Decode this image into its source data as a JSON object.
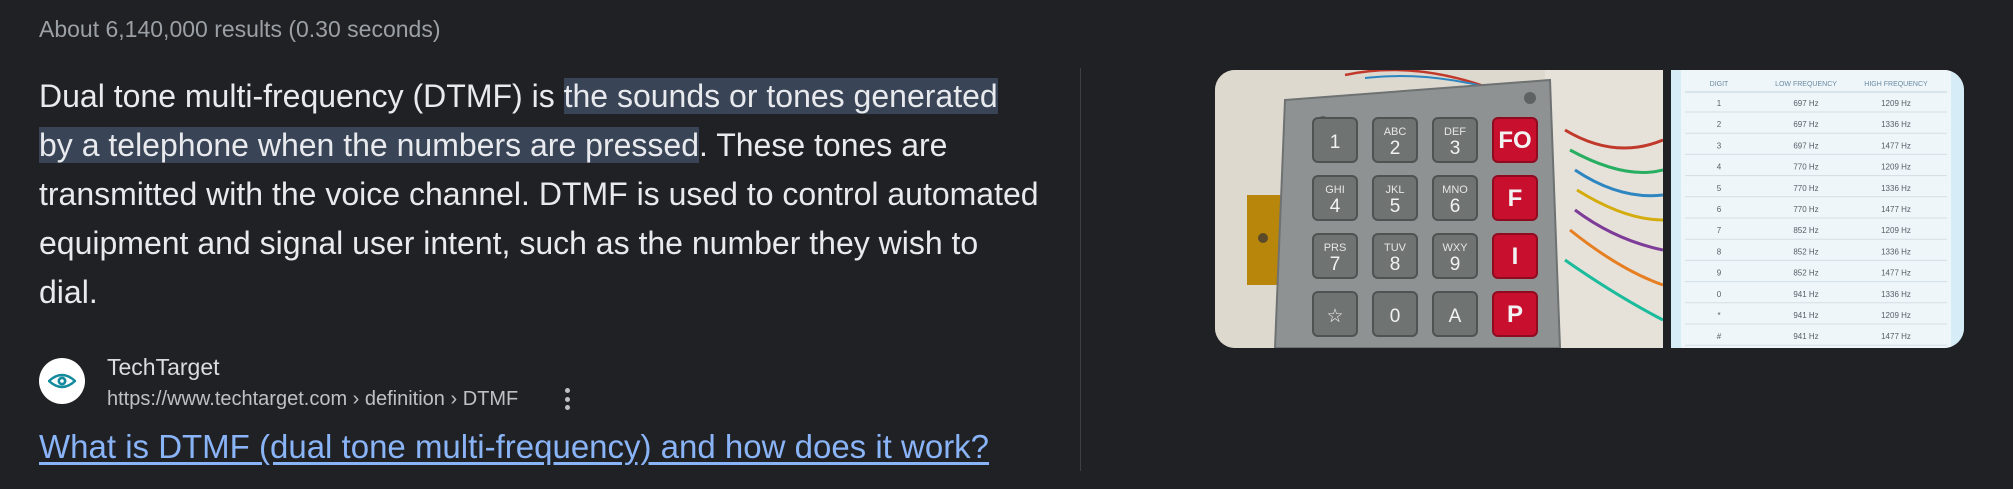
{
  "stats_text": "About 6,140,000 results (0.30 seconds)",
  "snippet": {
    "part1": "Dual tone multi-frequency (DTMF) is ",
    "highlight": "the sounds or tones generated by a telephone when the numbers are pressed",
    "part2": ". These tones are transmitted with the voice channel. DTMF is used to control automated equipment and signal user intent, such as the number they wish to dial."
  },
  "source": {
    "name": "TechTarget",
    "url": "https://www.techtarget.com › definition › DTMF",
    "favicon": "eye-icon"
  },
  "result_title": "What is DTMF (dual tone multi-frequency) and how does it work?",
  "colors": {
    "background": "#202124",
    "link": "#8ab4f8",
    "highlight": "#394457"
  },
  "keypad_keys": [
    {
      "main": "1",
      "letters": ""
    },
    {
      "main": "2",
      "letters": "ABC"
    },
    {
      "main": "3",
      "letters": "DEF"
    },
    {
      "main": "FO",
      "letters": "",
      "red": true
    },
    {
      "main": "4",
      "letters": "GHI"
    },
    {
      "main": "5",
      "letters": "JKL"
    },
    {
      "main": "6",
      "letters": "MNO"
    },
    {
      "main": "F",
      "letters": "",
      "red": true
    },
    {
      "main": "7",
      "letters": "PRS"
    },
    {
      "main": "8",
      "letters": "TUV"
    },
    {
      "main": "9",
      "letters": "WXY"
    },
    {
      "main": "I",
      "letters": "",
      "red": true
    },
    {
      "main": "☆",
      "letters": ""
    },
    {
      "main": "0",
      "letters": ""
    },
    {
      "main": "A",
      "letters": ""
    },
    {
      "main": "P",
      "letters": "",
      "red": true
    }
  ],
  "freq_table": {
    "headers": [
      "DIGIT",
      "LOW FREQUENCY",
      "HIGH FREQUENCY"
    ],
    "rows": [
      [
        "1",
        "697 Hz",
        "1209 Hz"
      ],
      [
        "2",
        "697 Hz",
        "1336 Hz"
      ],
      [
        "3",
        "697 Hz",
        "1477 Hz"
      ],
      [
        "4",
        "770 Hz",
        "1209 Hz"
      ],
      [
        "5",
        "770 Hz",
        "1336 Hz"
      ],
      [
        "6",
        "770 Hz",
        "1477 Hz"
      ],
      [
        "7",
        "852 Hz",
        "1209 Hz"
      ],
      [
        "8",
        "852 Hz",
        "1336 Hz"
      ],
      [
        "9",
        "852 Hz",
        "1477 Hz"
      ],
      [
        "0",
        "941 Hz",
        "1336 Hz"
      ],
      [
        "*",
        "941 Hz",
        "1209 Hz"
      ],
      [
        "#",
        "941 Hz",
        "1477 Hz"
      ]
    ]
  }
}
